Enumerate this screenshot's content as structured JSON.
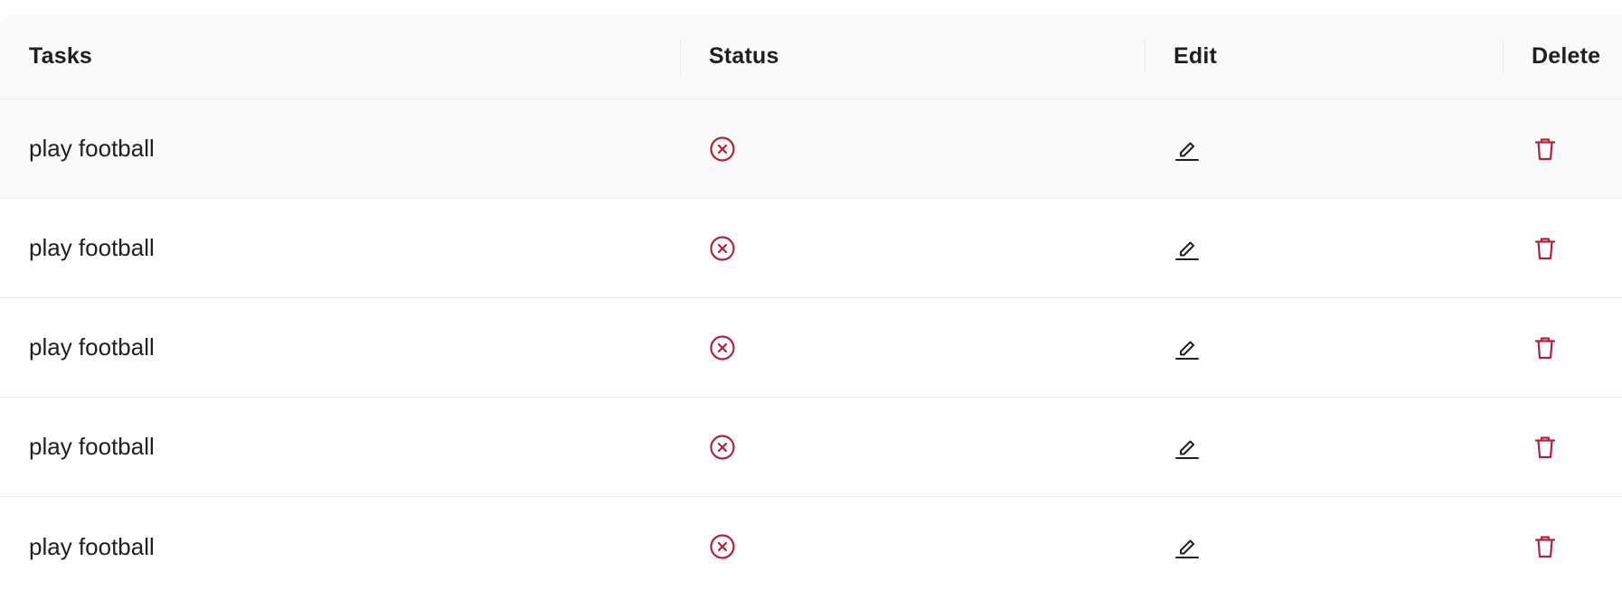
{
  "table": {
    "headers": {
      "tasks": "Tasks",
      "status": "Status",
      "edit": "Edit",
      "delete": "Delete"
    },
    "rows": [
      {
        "task": "play football",
        "status_icon": "close-circle-icon",
        "edit_icon": "edit-icon",
        "delete_icon": "delete-icon"
      },
      {
        "task": "play football",
        "status_icon": "close-circle-icon",
        "edit_icon": "edit-icon",
        "delete_icon": "delete-icon"
      },
      {
        "task": "play football",
        "status_icon": "close-circle-icon",
        "edit_icon": "edit-icon",
        "delete_icon": "delete-icon"
      },
      {
        "task": "play football",
        "status_icon": "close-circle-icon",
        "edit_icon": "edit-icon",
        "delete_icon": "delete-icon"
      },
      {
        "task": "play football",
        "status_icon": "close-circle-icon",
        "edit_icon": "edit-icon",
        "delete_icon": "delete-icon"
      }
    ]
  },
  "colors": {
    "status_icon": "#b5203a",
    "delete_icon": "#b5203a",
    "edit_icon": "#1f1f1f",
    "header_bg": "#fafafa",
    "border": "#ececec"
  }
}
